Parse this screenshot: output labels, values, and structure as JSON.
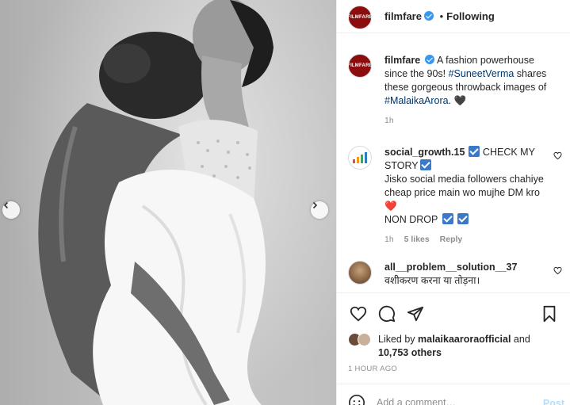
{
  "post": {
    "author": "filmfare",
    "avatar_text": "FILMFARE",
    "following_label": "Following",
    "dot": "•"
  },
  "caption": {
    "user": "filmfare",
    "text_1": "A fashion powerhouse since the 90s! ",
    "hashtag_1": "#SuneetVerma",
    "text_2": " shares these gorgeous throwback images of ",
    "hashtag_2": "#MalaikaArora",
    "text_3": ". ",
    "emoji": "🖤",
    "time": "1h"
  },
  "comments": [
    {
      "user": "social_growth.15",
      "line1": "CHECK MY STORY",
      "line2": "Jisko social media followers chahiye cheap price main wo mujhe DM kro",
      "line3": "NON DROP",
      "heart_emoji": "❤️",
      "time": "1h",
      "likes": "5 likes",
      "reply": "Reply"
    },
    {
      "user": "all__problem__solution__37",
      "text": "वशीकरण करना या तोड़ना।"
    }
  ],
  "likes": {
    "prefix": "Liked by ",
    "user": "malaikaaroraofficial",
    "mid": " and",
    "count": "10,753 others"
  },
  "timestamp": "1 HOUR AGO",
  "add_comment": {
    "placeholder": "Add a comment…",
    "post_label": "Post"
  },
  "colors": {
    "brand": "#8b0d0d",
    "link": "#00376b",
    "verified": "#3897f0",
    "muted": "#8e8e8e"
  }
}
